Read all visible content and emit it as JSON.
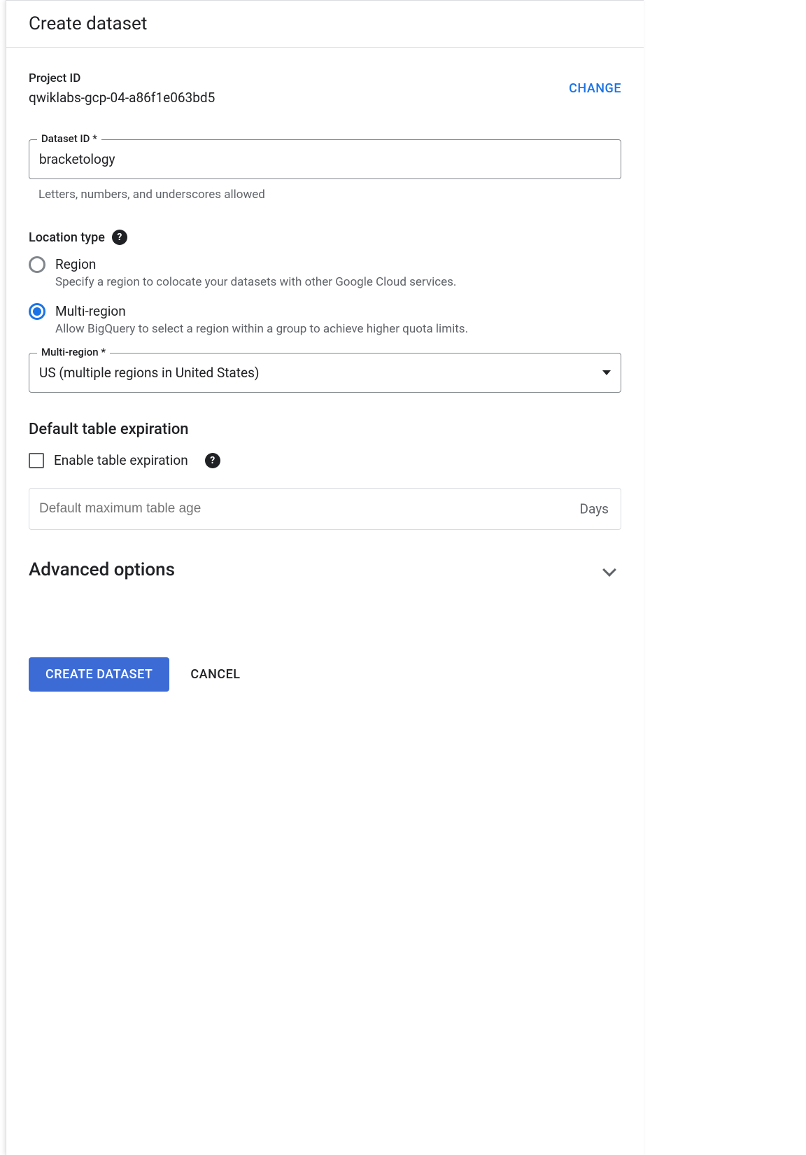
{
  "header": {
    "title": "Create dataset"
  },
  "project": {
    "label": "Project ID",
    "value": "qwiklabs-gcp-04-a86f1e063bd5",
    "change": "CHANGE"
  },
  "dataset_id": {
    "label": "Dataset ID *",
    "value": "bracketology",
    "helper": "Letters, numbers, and underscores allowed"
  },
  "location": {
    "label": "Location type",
    "options": [
      {
        "title": "Region",
        "desc": "Specify a region to colocate your datasets with other Google Cloud services.",
        "checked": false
      },
      {
        "title": "Multi-region",
        "desc": "Allow BigQuery to select a region within a group to achieve higher quota limits.",
        "checked": true
      }
    ]
  },
  "multi_region": {
    "label": "Multi-region *",
    "value": "US (multiple regions in United States)"
  },
  "expiration": {
    "heading": "Default table expiration",
    "checkbox_label": "Enable table expiration",
    "placeholder": "Default maximum table age",
    "suffix": "Days"
  },
  "advanced": {
    "title": "Advanced options"
  },
  "buttons": {
    "create": "CREATE DATASET",
    "cancel": "CANCEL"
  }
}
